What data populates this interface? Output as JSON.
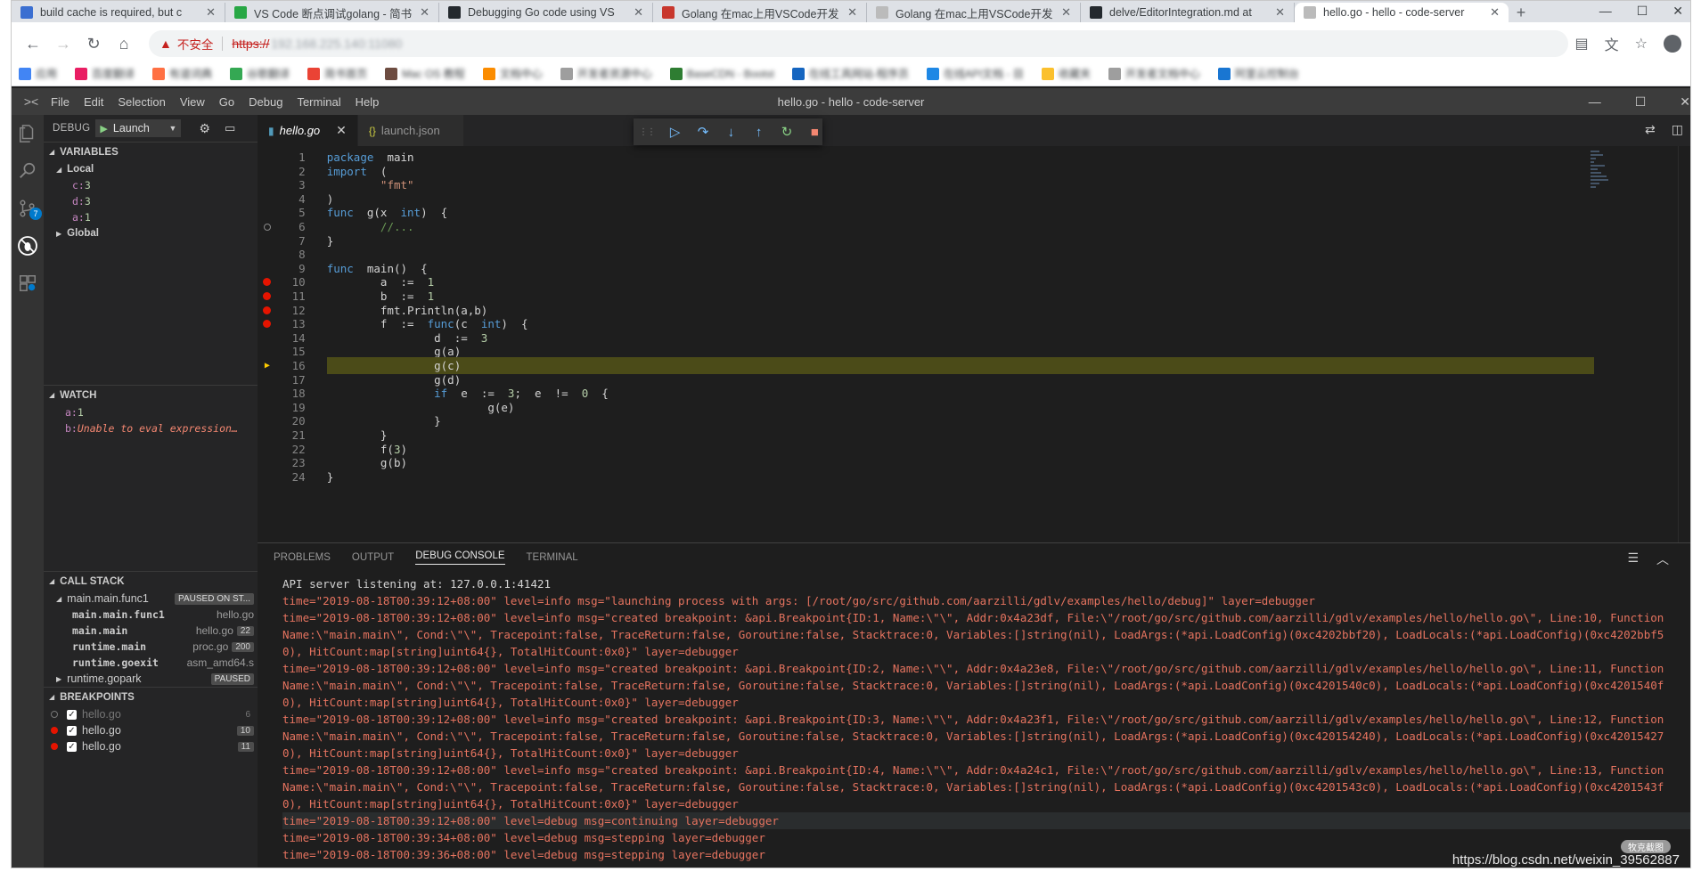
{
  "browser": {
    "tabs": [
      {
        "title": "build cache is required, but c",
        "color": "#3b6fd1"
      },
      {
        "title": "VS Code 断点调试golang - 简书",
        "color": "#28a745"
      },
      {
        "title": "Debugging Go code using VS",
        "color": "#24292e"
      },
      {
        "title": "Golang 在mac上用VSCode开发",
        "color": "#c8372d"
      },
      {
        "title": "Golang 在mac上用VSCode开发",
        "color": "#bbbbbb"
      },
      {
        "title": "delve/EditorIntegration.md at",
        "color": "#24292e"
      },
      {
        "title": "hello.go - hello - code-server",
        "color": "#bbbbbb"
      }
    ],
    "new_tab": "+",
    "window_controls": {
      "minimize": "—",
      "maximize": "☐",
      "close": "✕"
    },
    "security_label": "不安全",
    "url_scheme": "https://",
    "url_host": "192.168.225.140:11080",
    "bookmarks": [
      {
        "label": "应用",
        "color": "#4285f4"
      },
      {
        "label": "百度翻译",
        "color": "#e91e63"
      },
      {
        "label": "有道词典",
        "color": "#ff7043"
      },
      {
        "label": "谷歌翻译",
        "color": "#34a853"
      },
      {
        "label": "简书首页",
        "color": "#ea4335"
      },
      {
        "label": "Mac OS 教程",
        "color": "#6d4c41"
      },
      {
        "label": "文档中心",
        "color": "#fb8c00"
      },
      {
        "label": "开发者资源中心",
        "color": "#9e9e9e"
      },
      {
        "label": "BaseCDN - Bootst",
        "color": "#2e7d32"
      },
      {
        "label": "在线工具网站-程序员",
        "color": "#1565c0"
      },
      {
        "label": "在线API文档 - 目",
        "color": "#1e88e5"
      },
      {
        "label": "收藏夹",
        "color": "#fbc02d"
      },
      {
        "label": "开发者文档中心",
        "color": "#9e9e9e"
      },
      {
        "label": "阿里云控制台",
        "color": "#1976d2"
      }
    ]
  },
  "vscode": {
    "menu": [
      "File",
      "Edit",
      "Selection",
      "View",
      "Go",
      "Debug",
      "Terminal",
      "Help"
    ],
    "window_title": "hello.go - hello - code-server",
    "scm_badge": "7",
    "debug_label": "DEBUG",
    "launch_config": "Launch",
    "variables": {
      "header": "VARIABLES",
      "local_label": "Local",
      "locals": [
        {
          "name": "c",
          "value": "3"
        },
        {
          "name": "d",
          "value": "3"
        },
        {
          "name": "a",
          "value": "1"
        }
      ],
      "global_label": "Global"
    },
    "watch": {
      "header": "WATCH",
      "items": [
        {
          "name": "a",
          "value": "1",
          "error": false
        },
        {
          "name": "b",
          "value": "Unable to eval expression…",
          "error": true
        }
      ]
    },
    "call_stack": {
      "header": "CALL STACK",
      "thread": "main.main.func1",
      "thread_status": "PAUSED ON ST...",
      "frames": [
        {
          "fn": "main.main.func1",
          "file": "hello.go",
          "line": ""
        },
        {
          "fn": "main.main",
          "file": "hello.go",
          "line": "22"
        },
        {
          "fn": "runtime.main",
          "file": "proc.go",
          "line": "200"
        },
        {
          "fn": "runtime.goexit",
          "file": "asm_amd64.s",
          "line": ""
        }
      ],
      "thread2": "runtime.gopark",
      "thread2_status": "PAUSED"
    },
    "breakpoints": {
      "header": "BREAKPOINTS",
      "items": [
        {
          "file": "hello.go",
          "line": "6",
          "enabled": false
        },
        {
          "file": "hello.go",
          "line": "10",
          "enabled": true
        },
        {
          "file": "hello.go",
          "line": "11",
          "enabled": true
        }
      ]
    },
    "editor_tabs": [
      {
        "label": "hello.go",
        "icon": "go-file-icon",
        "active": true
      },
      {
        "label": "launch.json",
        "icon": "json-file-icon",
        "active": false
      }
    ],
    "code_lines": [
      {
        "n": "1",
        "html": "<span class='kw'>package</span>  main",
        "bp": ""
      },
      {
        "n": "2",
        "html": "<span class='kw'>import</span>  (",
        "bp": ""
      },
      {
        "n": "3",
        "html": "        <span class='str'>\"fmt\"</span>",
        "bp": ""
      },
      {
        "n": "4",
        "html": ")",
        "bp": ""
      },
      {
        "n": "5",
        "html": "<span class='kw'>func</span>  g(x  <span class='kw'>int</span>)  {",
        "bp": ""
      },
      {
        "n": "6",
        "html": "        <span class='cmt'>//...</span>",
        "bp": "hollow"
      },
      {
        "n": "7",
        "html": "}",
        "bp": ""
      },
      {
        "n": "8",
        "html": "",
        "bp": ""
      },
      {
        "n": "9",
        "html": "<span class='kw'>func</span>  main()  {",
        "bp": ""
      },
      {
        "n": "10",
        "html": "        a  :=  <span class='num'>1</span>",
        "bp": "on"
      },
      {
        "n": "11",
        "html": "        b  :=  <span class='num'>1</span>",
        "bp": "on"
      },
      {
        "n": "12",
        "html": "        fmt.Println(a,b)",
        "bp": "on"
      },
      {
        "n": "13",
        "html": "        f  :=  <span class='kw'>func</span>(c  <span class='kw'>int</span>)  {",
        "bp": "on"
      },
      {
        "n": "14",
        "html": "                d  :=  <span class='num'>3</span>",
        "bp": ""
      },
      {
        "n": "15",
        "html": "                g(a)",
        "bp": ""
      },
      {
        "n": "16",
        "html": "                g(c)",
        "bp": "current"
      },
      {
        "n": "17",
        "html": "                g(d)",
        "bp": ""
      },
      {
        "n": "18",
        "html": "                <span class='kw'>if</span>  e  :=  <span class='num'>3</span>;  e  !=  <span class='num'>0</span>  {",
        "bp": ""
      },
      {
        "n": "19",
        "html": "                        g(e)",
        "bp": ""
      },
      {
        "n": "20",
        "html": "                }",
        "bp": ""
      },
      {
        "n": "21",
        "html": "        }",
        "bp": ""
      },
      {
        "n": "22",
        "html": "        f(<span class='num'>3</span>)",
        "bp": ""
      },
      {
        "n": "23",
        "html": "        g(b)",
        "bp": ""
      },
      {
        "n": "24",
        "html": "}",
        "bp": ""
      }
    ],
    "panel_tabs": [
      "PROBLEMS",
      "OUTPUT",
      "DEBUG CONSOLE",
      "TERMINAL"
    ],
    "panel_active": "DEBUG CONSOLE",
    "console_lines": [
      {
        "text": "API server listening at: 127.0.0.1:41421",
        "kind": "api"
      },
      {
        "text": "time=\"2019-08-18T00:39:12+08:00\" level=info msg=\"launching process with args: [/root/go/src/github.com/aarzilli/gdlv/examples/hello/debug]\" layer=debugger",
        "kind": "log"
      },
      {
        "text": "time=\"2019-08-18T00:39:12+08:00\" level=info msg=\"created breakpoint: &api.Breakpoint{ID:1, Name:\\\"\\\", Addr:0x4a23df, File:\\\"/root/go/src/github.com/aarzilli/gdlv/examples/hello/hello.go\\\", Line:10, FunctionName:\\\"main.main\\\", Cond:\\\"\\\", Tracepoint:false, TraceReturn:false, Goroutine:false, Stacktrace:0, Variables:[]string(nil), LoadArgs:(*api.LoadConfig)(0xc4202bbf20), LoadLocals:(*api.LoadConfig)(0xc4202bbf50), HitCount:map[string]uint64{}, TotalHitCount:0x0}\" layer=debugger",
        "kind": "log"
      },
      {
        "text": "time=\"2019-08-18T00:39:12+08:00\" level=info msg=\"created breakpoint: &api.Breakpoint{ID:2, Name:\\\"\\\", Addr:0x4a23e8, File:\\\"/root/go/src/github.com/aarzilli/gdlv/examples/hello/hello.go\\\", Line:11, FunctionName:\\\"main.main\\\", Cond:\\\"\\\", Tracepoint:false, TraceReturn:false, Goroutine:false, Stacktrace:0, Variables:[]string(nil), LoadArgs:(*api.LoadConfig)(0xc4201540c0), LoadLocals:(*api.LoadConfig)(0xc4201540f0), HitCount:map[string]uint64{}, TotalHitCount:0x0}\" layer=debugger",
        "kind": "log"
      },
      {
        "text": "time=\"2019-08-18T00:39:12+08:00\" level=info msg=\"created breakpoint: &api.Breakpoint{ID:3, Name:\\\"\\\", Addr:0x4a23f1, File:\\\"/root/go/src/github.com/aarzilli/gdlv/examples/hello/hello.go\\\", Line:12, FunctionName:\\\"main.main\\\", Cond:\\\"\\\", Tracepoint:false, TraceReturn:false, Goroutine:false, Stacktrace:0, Variables:[]string(nil), LoadArgs:(*api.LoadConfig)(0xc420154240), LoadLocals:(*api.LoadConfig)(0xc420154270), HitCount:map[string]uint64{}, TotalHitCount:0x0}\" layer=debugger",
        "kind": "log"
      },
      {
        "text": "time=\"2019-08-18T00:39:12+08:00\" level=info msg=\"created breakpoint: &api.Breakpoint{ID:4, Name:\\\"\\\", Addr:0x4a24c1, File:\\\"/root/go/src/github.com/aarzilli/gdlv/examples/hello/hello.go\\\", Line:13, FunctionName:\\\"main.main\\\", Cond:\\\"\\\", Tracepoint:false, TraceReturn:false, Goroutine:false, Stacktrace:0, Variables:[]string(nil), LoadArgs:(*api.LoadConfig)(0xc4201543c0), LoadLocals:(*api.LoadConfig)(0xc4201543f0), HitCount:map[string]uint64{}, TotalHitCount:0x0}\" layer=debugger",
        "kind": "log"
      },
      {
        "text": "time=\"2019-08-18T00:39:12+08:00\" level=debug msg=continuing layer=debugger",
        "kind": "sel"
      },
      {
        "text": "time=\"2019-08-18T00:39:34+08:00\" level=debug msg=stepping layer=debugger",
        "kind": "log"
      },
      {
        "text": "time=\"2019-08-18T00:39:36+08:00\" level=debug msg=stepping layer=debugger",
        "kind": "log"
      }
    ],
    "watermark": "https://blog.csdn.net/weixin_39562887",
    "watermark_badge": "牧克截图"
  }
}
